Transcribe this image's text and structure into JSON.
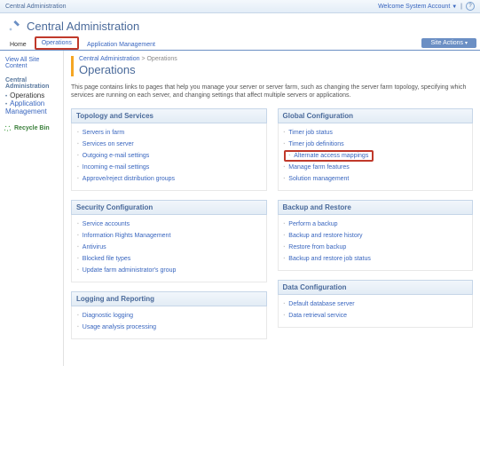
{
  "topbar": {
    "left_text": "Central Administration",
    "welcome": "Welcome System Account"
  },
  "header": {
    "title": "Central Administration"
  },
  "tabs": {
    "home": "Home",
    "operations": "Operations",
    "appmgmt": "Application Management"
  },
  "site_actions": "Site Actions",
  "sidebar": {
    "view_all": "View All Site Content",
    "block_title": "Central Administration",
    "items": [
      {
        "label": "Operations",
        "current": true
      },
      {
        "label": "Application Management",
        "current": false
      }
    ],
    "recycle": "Recycle Bin"
  },
  "breadcrumb": {
    "root": "Central Administration",
    "sep": ">",
    "current": "Operations"
  },
  "page_title": "Operations",
  "intro": "This page contains links to pages that help you manage your server or server farm, such as changing the server farm topology, specifying which services are running on each server, and changing settings that affect multiple servers or applications.",
  "left_sections": [
    {
      "title": "Topology and Services",
      "items": [
        "Servers in farm",
        "Services on server",
        "Outgoing e-mail settings",
        "Incoming e-mail settings",
        "Approve/reject distribution groups"
      ]
    },
    {
      "title": "Security Configuration",
      "items": [
        "Service accounts",
        "Information Rights Management",
        "Antivirus",
        "Blocked file types",
        "Update farm administrator's group"
      ]
    },
    {
      "title": "Logging and Reporting",
      "items": [
        "Diagnostic logging",
        "Usage analysis processing"
      ]
    }
  ],
  "right_sections": [
    {
      "title": "Global Configuration",
      "items": [
        "Timer job status",
        "Timer job definitions",
        "Alternate access mappings",
        "Manage farm features",
        "Solution management"
      ],
      "highlight_index": 2
    },
    {
      "title": "Backup and Restore",
      "items": [
        "Perform a backup",
        "Backup and restore history",
        "Restore from backup",
        "Backup and restore job status"
      ]
    },
    {
      "title": "Data Configuration",
      "items": [
        "Default database server",
        "Data retrieval service"
      ]
    }
  ]
}
